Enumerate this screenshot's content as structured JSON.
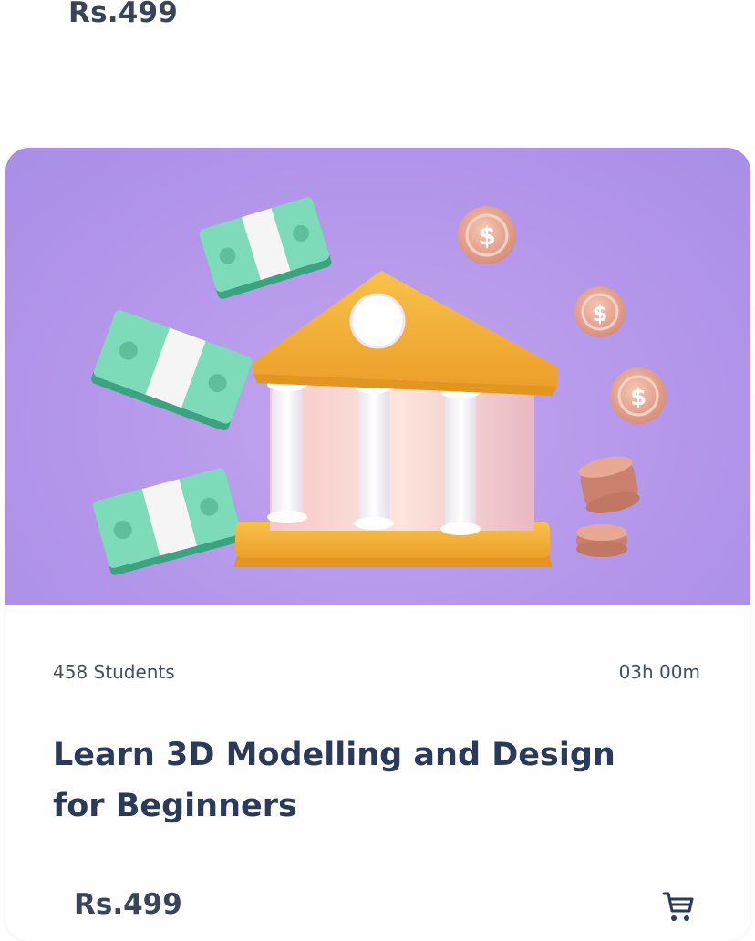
{
  "top_card": {
    "price": "Rs.499"
  },
  "course_card": {
    "students": "458 Students",
    "duration": "03h 00m",
    "title": "Learn 3D Modelling and Design for Beginners",
    "price": "Rs.499",
    "cart_icon": "cart-icon",
    "hero_icon": "bank-with-money-icon",
    "colors": {
      "hero_bg": "#b497ea",
      "title": "#2b3a58",
      "bank_roof": "#f4b73f",
      "cash_green": "#6fd3b0",
      "coin": "#e6a48f"
    }
  }
}
